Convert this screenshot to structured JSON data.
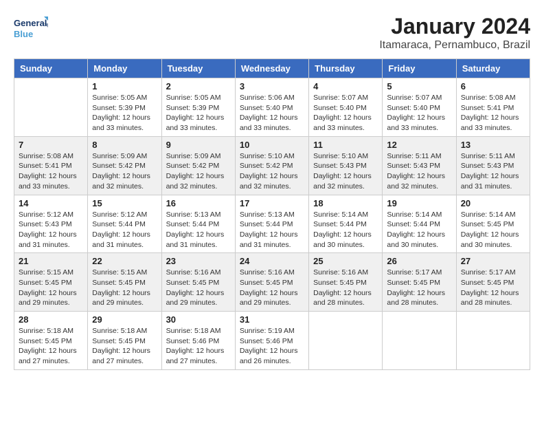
{
  "logo": {
    "line1": "General",
    "line2": "Blue"
  },
  "title": "January 2024",
  "subtitle": "Itamaraca, Pernambuco, Brazil",
  "days_of_week": [
    "Sunday",
    "Monday",
    "Tuesday",
    "Wednesday",
    "Thursday",
    "Friday",
    "Saturday"
  ],
  "weeks": [
    [
      {
        "day": "",
        "info": ""
      },
      {
        "day": "1",
        "info": "Sunrise: 5:05 AM\nSunset: 5:39 PM\nDaylight: 12 hours\nand 33 minutes."
      },
      {
        "day": "2",
        "info": "Sunrise: 5:05 AM\nSunset: 5:39 PM\nDaylight: 12 hours\nand 33 minutes."
      },
      {
        "day": "3",
        "info": "Sunrise: 5:06 AM\nSunset: 5:40 PM\nDaylight: 12 hours\nand 33 minutes."
      },
      {
        "day": "4",
        "info": "Sunrise: 5:07 AM\nSunset: 5:40 PM\nDaylight: 12 hours\nand 33 minutes."
      },
      {
        "day": "5",
        "info": "Sunrise: 5:07 AM\nSunset: 5:40 PM\nDaylight: 12 hours\nand 33 minutes."
      },
      {
        "day": "6",
        "info": "Sunrise: 5:08 AM\nSunset: 5:41 PM\nDaylight: 12 hours\nand 33 minutes."
      }
    ],
    [
      {
        "day": "7",
        "info": "Sunrise: 5:08 AM\nSunset: 5:41 PM\nDaylight: 12 hours\nand 33 minutes."
      },
      {
        "day": "8",
        "info": "Sunrise: 5:09 AM\nSunset: 5:42 PM\nDaylight: 12 hours\nand 32 minutes."
      },
      {
        "day": "9",
        "info": "Sunrise: 5:09 AM\nSunset: 5:42 PM\nDaylight: 12 hours\nand 32 minutes."
      },
      {
        "day": "10",
        "info": "Sunrise: 5:10 AM\nSunset: 5:42 PM\nDaylight: 12 hours\nand 32 minutes."
      },
      {
        "day": "11",
        "info": "Sunrise: 5:10 AM\nSunset: 5:43 PM\nDaylight: 12 hours\nand 32 minutes."
      },
      {
        "day": "12",
        "info": "Sunrise: 5:11 AM\nSunset: 5:43 PM\nDaylight: 12 hours\nand 32 minutes."
      },
      {
        "day": "13",
        "info": "Sunrise: 5:11 AM\nSunset: 5:43 PM\nDaylight: 12 hours\nand 31 minutes."
      }
    ],
    [
      {
        "day": "14",
        "info": "Sunrise: 5:12 AM\nSunset: 5:43 PM\nDaylight: 12 hours\nand 31 minutes."
      },
      {
        "day": "15",
        "info": "Sunrise: 5:12 AM\nSunset: 5:44 PM\nDaylight: 12 hours\nand 31 minutes."
      },
      {
        "day": "16",
        "info": "Sunrise: 5:13 AM\nSunset: 5:44 PM\nDaylight: 12 hours\nand 31 minutes."
      },
      {
        "day": "17",
        "info": "Sunrise: 5:13 AM\nSunset: 5:44 PM\nDaylight: 12 hours\nand 31 minutes."
      },
      {
        "day": "18",
        "info": "Sunrise: 5:14 AM\nSunset: 5:44 PM\nDaylight: 12 hours\nand 30 minutes."
      },
      {
        "day": "19",
        "info": "Sunrise: 5:14 AM\nSunset: 5:44 PM\nDaylight: 12 hours\nand 30 minutes."
      },
      {
        "day": "20",
        "info": "Sunrise: 5:14 AM\nSunset: 5:45 PM\nDaylight: 12 hours\nand 30 minutes."
      }
    ],
    [
      {
        "day": "21",
        "info": "Sunrise: 5:15 AM\nSunset: 5:45 PM\nDaylight: 12 hours\nand 29 minutes."
      },
      {
        "day": "22",
        "info": "Sunrise: 5:15 AM\nSunset: 5:45 PM\nDaylight: 12 hours\nand 29 minutes."
      },
      {
        "day": "23",
        "info": "Sunrise: 5:16 AM\nSunset: 5:45 PM\nDaylight: 12 hours\nand 29 minutes."
      },
      {
        "day": "24",
        "info": "Sunrise: 5:16 AM\nSunset: 5:45 PM\nDaylight: 12 hours\nand 29 minutes."
      },
      {
        "day": "25",
        "info": "Sunrise: 5:16 AM\nSunset: 5:45 PM\nDaylight: 12 hours\nand 28 minutes."
      },
      {
        "day": "26",
        "info": "Sunrise: 5:17 AM\nSunset: 5:45 PM\nDaylight: 12 hours\nand 28 minutes."
      },
      {
        "day": "27",
        "info": "Sunrise: 5:17 AM\nSunset: 5:45 PM\nDaylight: 12 hours\nand 28 minutes."
      }
    ],
    [
      {
        "day": "28",
        "info": "Sunrise: 5:18 AM\nSunset: 5:45 PM\nDaylight: 12 hours\nand 27 minutes."
      },
      {
        "day": "29",
        "info": "Sunrise: 5:18 AM\nSunset: 5:45 PM\nDaylight: 12 hours\nand 27 minutes."
      },
      {
        "day": "30",
        "info": "Sunrise: 5:18 AM\nSunset: 5:46 PM\nDaylight: 12 hours\nand 27 minutes."
      },
      {
        "day": "31",
        "info": "Sunrise: 5:19 AM\nSunset: 5:46 PM\nDaylight: 12 hours\nand 26 minutes."
      },
      {
        "day": "",
        "info": ""
      },
      {
        "day": "",
        "info": ""
      },
      {
        "day": "",
        "info": ""
      }
    ]
  ]
}
